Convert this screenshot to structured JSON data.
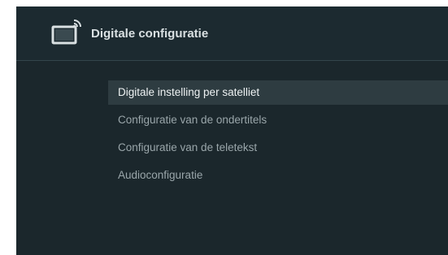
{
  "header": {
    "title": "Digitale configuratie",
    "icon": "tv-satellite-icon"
  },
  "menu": {
    "items": [
      {
        "label": "Digitale instelling per satelliet",
        "selected": true
      },
      {
        "label": "Configuratie van de ondertitels",
        "selected": false
      },
      {
        "label": "Configuratie van de teletekst",
        "selected": false
      },
      {
        "label": "Audioconfiguratie",
        "selected": false
      }
    ]
  },
  "colors": {
    "background": "#1b272c",
    "selection": "#2e3c41",
    "text_selected": "#eef2f3",
    "text_normal": "#9aa6aa"
  }
}
